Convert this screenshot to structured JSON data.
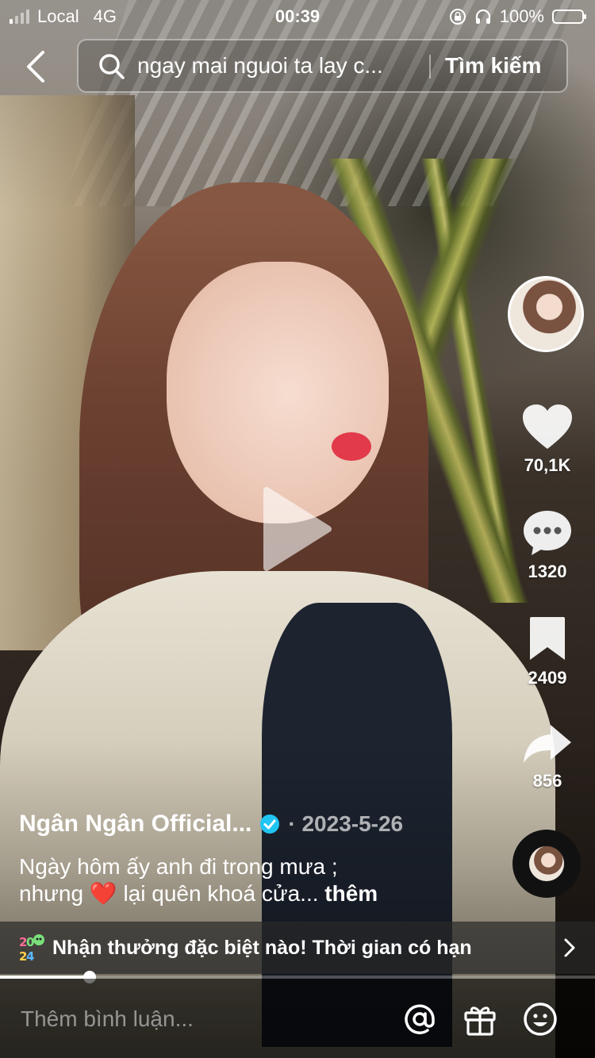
{
  "status_bar": {
    "carrier": "Local",
    "network": "4G",
    "time": "00:39",
    "battery": "100%"
  },
  "search": {
    "query": "ngay mai nguoi ta lay c...",
    "submit_label": "Tìm kiếm"
  },
  "video": {
    "progress": 0.15
  },
  "actions": {
    "like_count": "70,1K",
    "comment_count": "1320",
    "save_count": "2409",
    "share_count": "856"
  },
  "post": {
    "author": "Ngân Ngân Official...",
    "date": "· 2023-5-26",
    "caption_line1": "Ngày hôm ấy anh đi trong mưa ;",
    "caption_line2_before": "nhưng",
    "caption_emoji": "❤️",
    "caption_line2_after": "lại quên khoá cửa...",
    "more_label": "thêm"
  },
  "promo": {
    "text": "Nhận thưởng đặc biệt nào! Thời gian có hạn"
  },
  "comment_bar": {
    "placeholder": "Thêm bình luận..."
  },
  "icons": {
    "verified_color": "#20c5f3",
    "heart": "heart-icon",
    "comment": "comment-icon",
    "bookmark": "bookmark-icon",
    "share": "share-icon"
  }
}
